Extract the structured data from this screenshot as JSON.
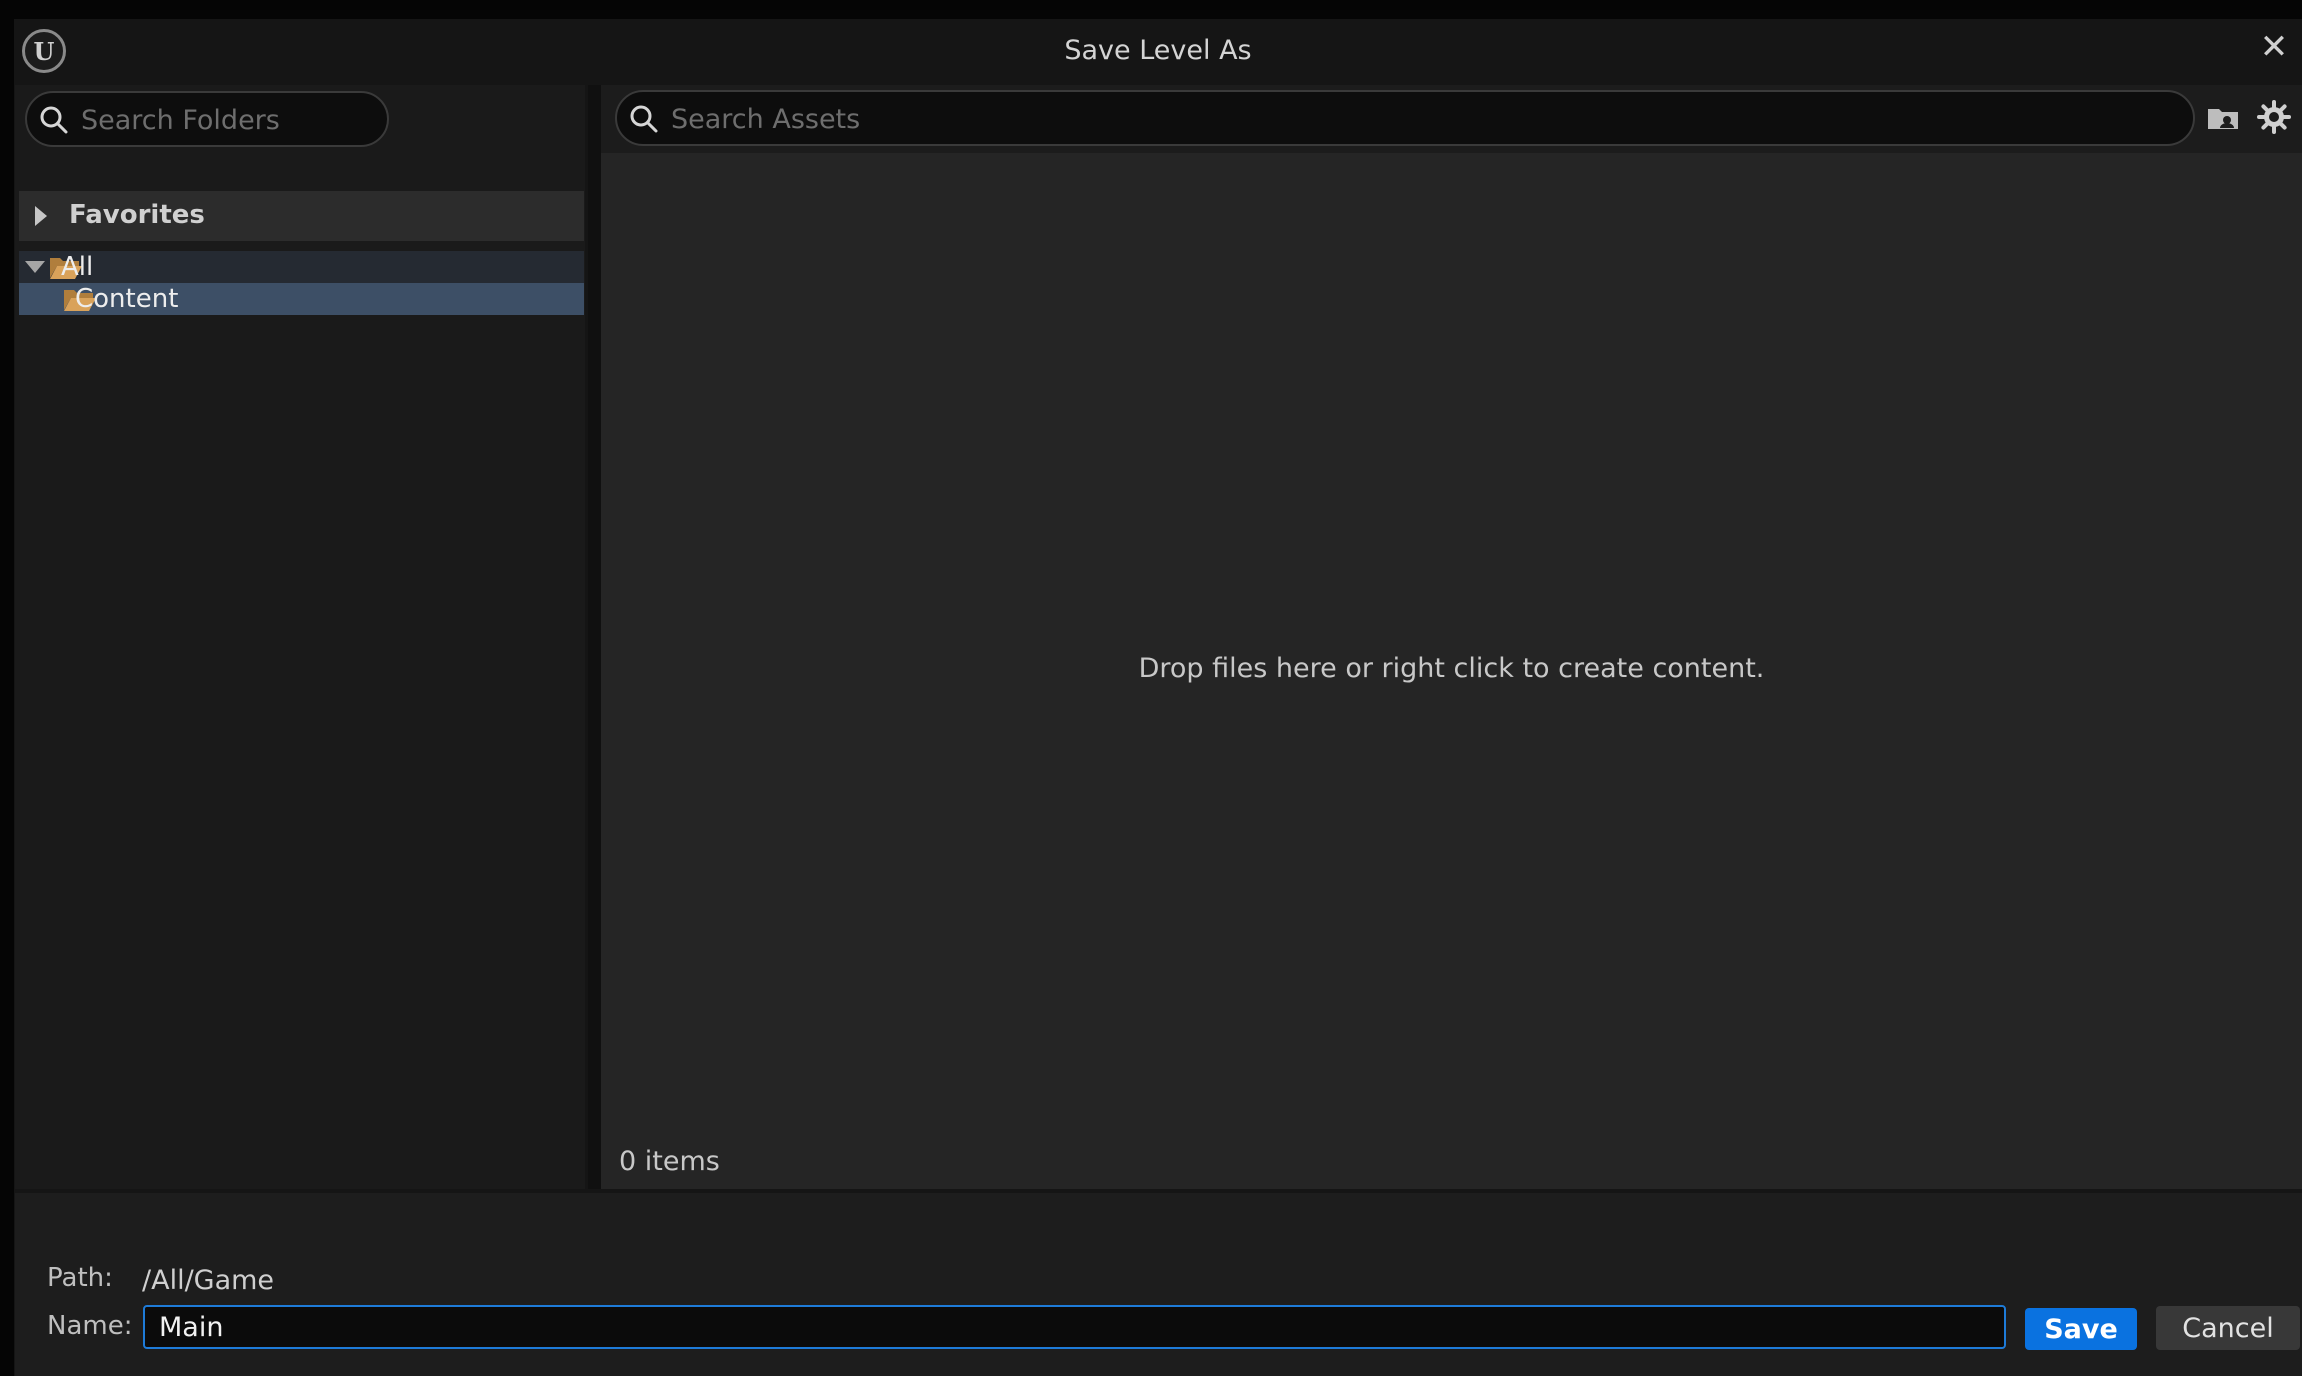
{
  "window": {
    "title": "Save Level As",
    "logo_letter": "U",
    "close_glyph": "✕"
  },
  "folders": {
    "search_placeholder": "Search Folders",
    "search_value": "",
    "favorites_label": "Favorites",
    "tree": [
      {
        "label": "All",
        "expanded": true,
        "selected": false
      },
      {
        "label": "Content",
        "expanded": false,
        "selected": true
      }
    ]
  },
  "assets": {
    "search_placeholder": "Search Assets",
    "search_value": "",
    "empty_message": "Drop files here or right click to create content.",
    "items_count": "0 items",
    "icons": [
      "folder-view-icon",
      "settings-gear-icon"
    ]
  },
  "footer": {
    "path_label": "Path:",
    "path_value": "/All/Game",
    "name_label": "Name:",
    "name_value": "Main",
    "save_label": "Save",
    "cancel_label": "Cancel"
  },
  "colors": {
    "accent": "#0a72e0",
    "input_focus_border": "#1e7bd8",
    "selection_row": "#3d4f66",
    "folder": "#d9a25a"
  }
}
